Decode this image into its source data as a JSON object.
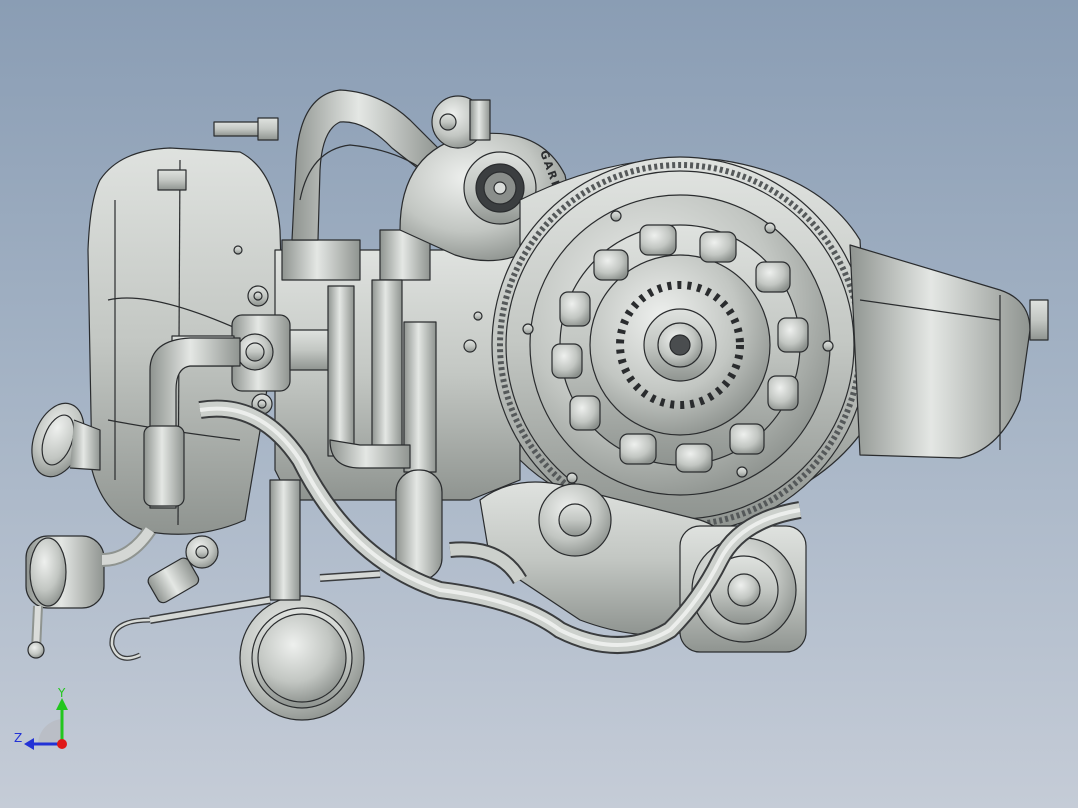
{
  "model": {
    "brand_text": "GARRETT",
    "shade_color": "#c8ccc8",
    "edge_color": "#2a2c2e"
  },
  "triad": {
    "y_label": "Y",
    "z_label": "Z",
    "y_color": "#22c61e",
    "z_color": "#2232d6",
    "x_color": "#e01818"
  }
}
